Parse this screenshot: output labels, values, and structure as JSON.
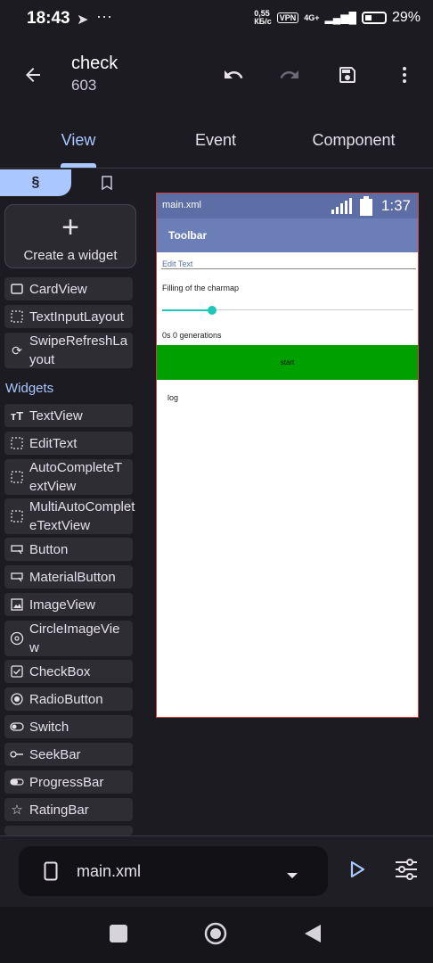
{
  "status_bar": {
    "time": "18:43",
    "speed": "0,55\nКБ/с",
    "vpn": "VPN",
    "network": "4G+",
    "battery": "29%"
  },
  "app_bar": {
    "title": "check",
    "subtitle": "603",
    "icons": [
      "back-arrow-icon",
      "undo-icon",
      "redo-icon",
      "save-icon",
      "more-vert-icon"
    ]
  },
  "tabs": [
    {
      "label": "View",
      "active": true
    },
    {
      "label": "Event",
      "active": false
    },
    {
      "label": "Component",
      "active": false
    }
  ],
  "palette": {
    "create_widget": "Create a widget",
    "layouts": [
      {
        "label": "CardView",
        "icon": "card-icon"
      },
      {
        "label": "TextInputLayout",
        "icon": "dashed-box-icon"
      },
      {
        "label": "SwipeRefreshLa\nyout",
        "icon": "refresh-icon"
      }
    ],
    "widgets_header": "Widgets",
    "widgets": [
      {
        "label": "TextView",
        "icon": "text-icon"
      },
      {
        "label": "EditText",
        "icon": "dashed-box-icon"
      },
      {
        "label": "AutoCompleteT\nextView",
        "icon": "dashed-box-icon"
      },
      {
        "label": "MultiAutoComplet\neTextView",
        "icon": "dashed-box-icon"
      },
      {
        "label": "Button",
        "icon": "button-icon"
      },
      {
        "label": "MaterialButton",
        "icon": "button-icon"
      },
      {
        "label": "ImageView",
        "icon": "image-icon"
      },
      {
        "label": "CircleImageVie\nw",
        "icon": "circle-image-icon"
      },
      {
        "label": "CheckBox",
        "icon": "checkbox-icon"
      },
      {
        "label": "RadioButton",
        "icon": "radio-icon"
      },
      {
        "label": "Switch",
        "icon": "switch-icon"
      },
      {
        "label": "SeekBar",
        "icon": "seekbar-icon"
      },
      {
        "label": "ProgressBar",
        "icon": "progress-icon"
      },
      {
        "label": "RatingBar",
        "icon": "star-icon"
      }
    ]
  },
  "preview": {
    "file": "main.xml",
    "time": "1:37",
    "toolbar": "Toolbar",
    "edit_text": "Edit Text",
    "filling": "Filling of the charmap",
    "seek_progress": 0.2,
    "generations": "0s 0 generations",
    "start": "start",
    "log": "log",
    "colors": {
      "status": "#5c6ea5",
      "toolbar": "#6b7eb8",
      "button": "#00a000",
      "seek": "#1fc7b8"
    }
  },
  "bottom": {
    "file": "main.xml"
  }
}
